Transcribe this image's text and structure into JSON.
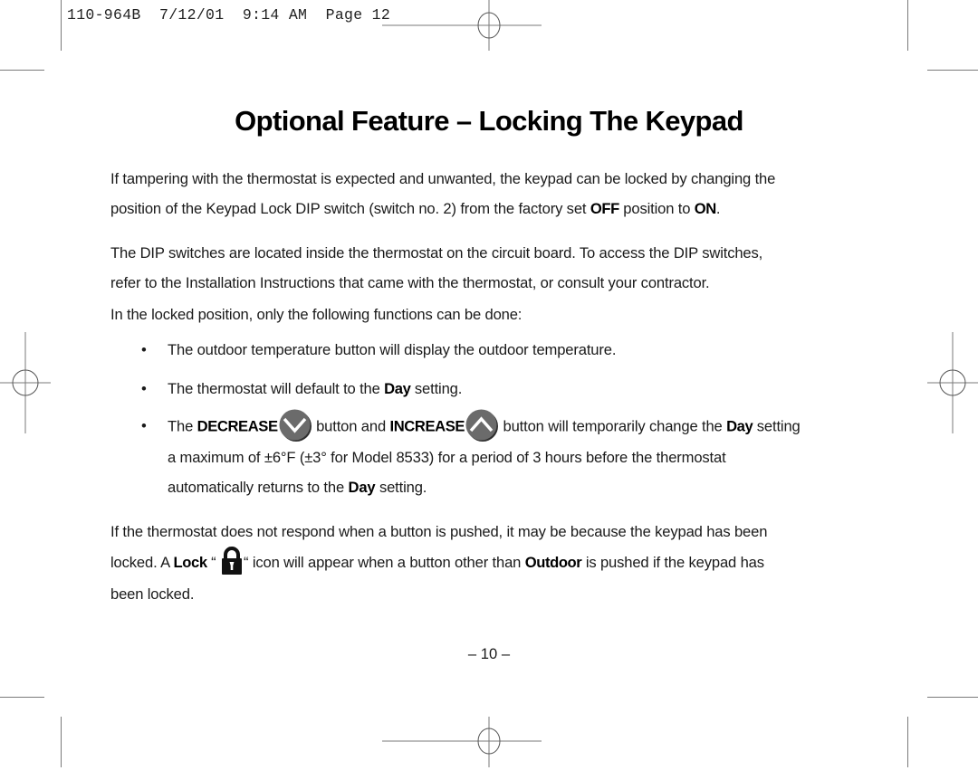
{
  "slug": {
    "text": "110-964B  7/12/01  9:14 AM  Page 12"
  },
  "title": "Optional Feature – Locking The Keypad",
  "paragraph1": {
    "line1": "If tampering with the thermostat is expected and unwanted, the keypad can be locked by changing the",
    "line2_pre": "position of the Keypad Lock DIP switch (switch no. 2) from the factory set ",
    "line2_bold1": "OFF",
    "line2_mid": " position to ",
    "line2_bold2": "ON",
    "line2_post": "."
  },
  "paragraph2": {
    "line1": "The DIP switches are located inside the thermostat on the circuit board. To access the DIP switches,",
    "line2": "refer to the Installation Instructions that came with the thermostat, or consult your contractor.",
    "line3": "In the locked position, only the following functions can be done:"
  },
  "bullets": {
    "marker": "•",
    "item1": "The outdoor temperature button will display the outdoor temperature.",
    "item2_pre": "The thermostat will default to the ",
    "item2_bold": "Day",
    "item2_post": " setting.",
    "item3_pre": "The ",
    "item3_bold1": "DECREASE",
    "item3_mid": " button and ",
    "item3_bold2": "INCREASE",
    "item3_post1": " button will temporarily change the ",
    "item3_bold3": "Day",
    "item3_post2": " setting",
    "item3_line2": "a maximum of ±6°F (±3° for Model 8533) for a period of 3 hours before the thermostat",
    "item3_line3_pre": "automatically returns to the ",
    "item3_line3_bold": "Day",
    "item3_line3_post": " setting."
  },
  "paragraph3": {
    "line1": "If the thermostat does not respond when a button is pushed, it may be because the keypad has been",
    "line2_pre": "locked. A ",
    "line2_bold1": "Lock",
    "line2_quote_open": " “ ",
    "line2_quote_close": "“  icon will appear when a button other than ",
    "line2_bold2": "Outdoor",
    "line2_post": " is pushed if the keypad has",
    "line3": "been locked."
  },
  "page_number": "– 10 –",
  "icons": {
    "decrease": "chevron-down-button",
    "increase": "chevron-up-button",
    "lock": "padlock"
  },
  "colors": {
    "button_fill": "#6b6b6b",
    "button_shadow": "#2e2e2e",
    "crop_marks": "#7a7a7a"
  }
}
